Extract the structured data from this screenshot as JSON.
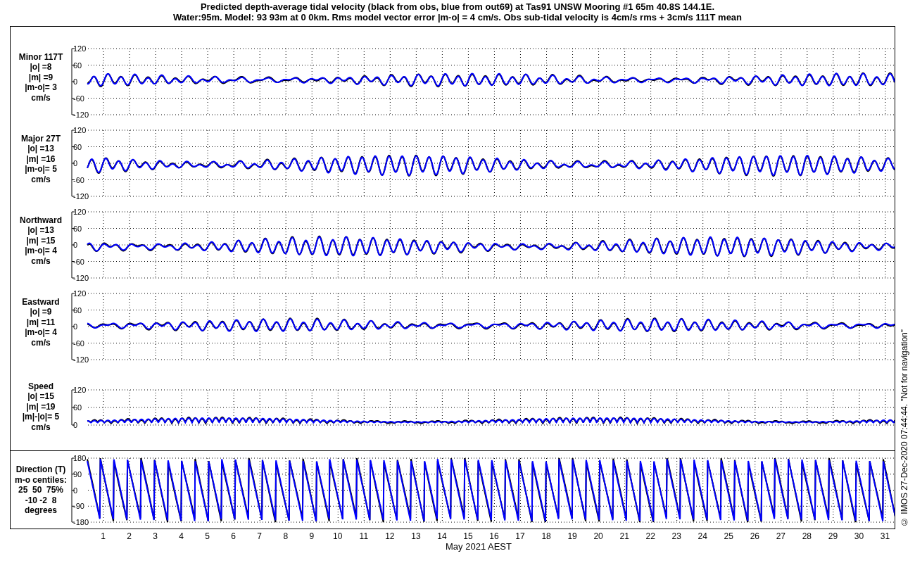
{
  "title": [
    "Predicted depth-average tidal velocity (black from obs, blue from out69) at Tas91 UNSW Mooring #1 65m 40.8S 144.1E.",
    "Water:95m. Model: 93 93m at 0 0km. Rms model vector error |m-o| = 4 cm/s. Obs sub-tidal velocity is 4cm/s rms + 3cm/s 111T mean"
  ],
  "panels": [
    {
      "kind": "velocity",
      "label": [
        "Minor 117T",
        "|o| =8",
        "|m| =9",
        "|m-o|= 3",
        "cm/s"
      ],
      "yticks": [
        "120",
        "60",
        "0",
        "-60",
        "-120"
      ]
    },
    {
      "kind": "velocity",
      "label": [
        "Major 27T",
        "|o| =13",
        "|m| =16",
        "|m-o|= 5",
        "cm/s"
      ],
      "yticks": [
        "120",
        "60",
        "0",
        "-60",
        "-120"
      ]
    },
    {
      "kind": "velocity",
      "label": [
        "Northward",
        "|o| =13",
        "|m| =15",
        "|m-o|= 4",
        "cm/s"
      ],
      "yticks": [
        "120",
        "60",
        "0",
        "-60",
        "-120"
      ]
    },
    {
      "kind": "velocity",
      "label": [
        "Eastward",
        "|o| =9",
        "|m| =11",
        "|m-o|= 4",
        "cm/s"
      ],
      "yticks": [
        "120",
        "60",
        "0",
        "-60",
        "-120"
      ]
    },
    {
      "kind": "speed",
      "label": [
        "Speed",
        "|o| =15",
        "|m| =19",
        "|m|-|o|= 5",
        "cm/s"
      ],
      "yticks": [
        "120",
        "60",
        "0"
      ]
    },
    {
      "kind": "direction",
      "label": [
        "Direction (T)",
        "m-o centiles:",
        "25  50  75%",
        "-10 -2  8",
        "degrees"
      ],
      "yticks": [
        "180",
        "90",
        "0",
        "-90",
        "-180"
      ]
    }
  ],
  "xaxis": {
    "ticks": [
      "1",
      "2",
      "3",
      "4",
      "5",
      "6",
      "7",
      "8",
      "9",
      "10",
      "11",
      "12",
      "13",
      "14",
      "15",
      "16",
      "17",
      "18",
      "19",
      "20",
      "21",
      "22",
      "23",
      "24",
      "25",
      "26",
      "27",
      "28",
      "29",
      "30",
      "31"
    ],
    "label": "May 2021 AEST"
  },
  "footer": "© IMOS 27-Dec-2020 07:44:44. \"Not for navigation\""
}
